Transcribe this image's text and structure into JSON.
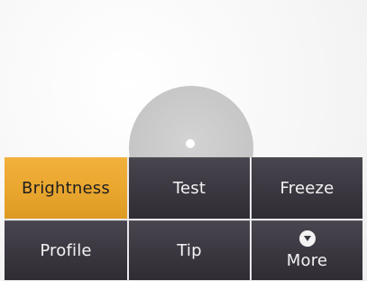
{
  "menu": {
    "brightness": "Brightness",
    "test": "Test",
    "freeze": "Freeze",
    "profile": "Profile",
    "tip": "Tip",
    "more": "More",
    "more_icon": "chevron-down-circle-icon",
    "active_item": "brightness"
  },
  "colors": {
    "active": "#e9a62f",
    "tile": "#3b3740",
    "disc": "#c7c7c7"
  }
}
